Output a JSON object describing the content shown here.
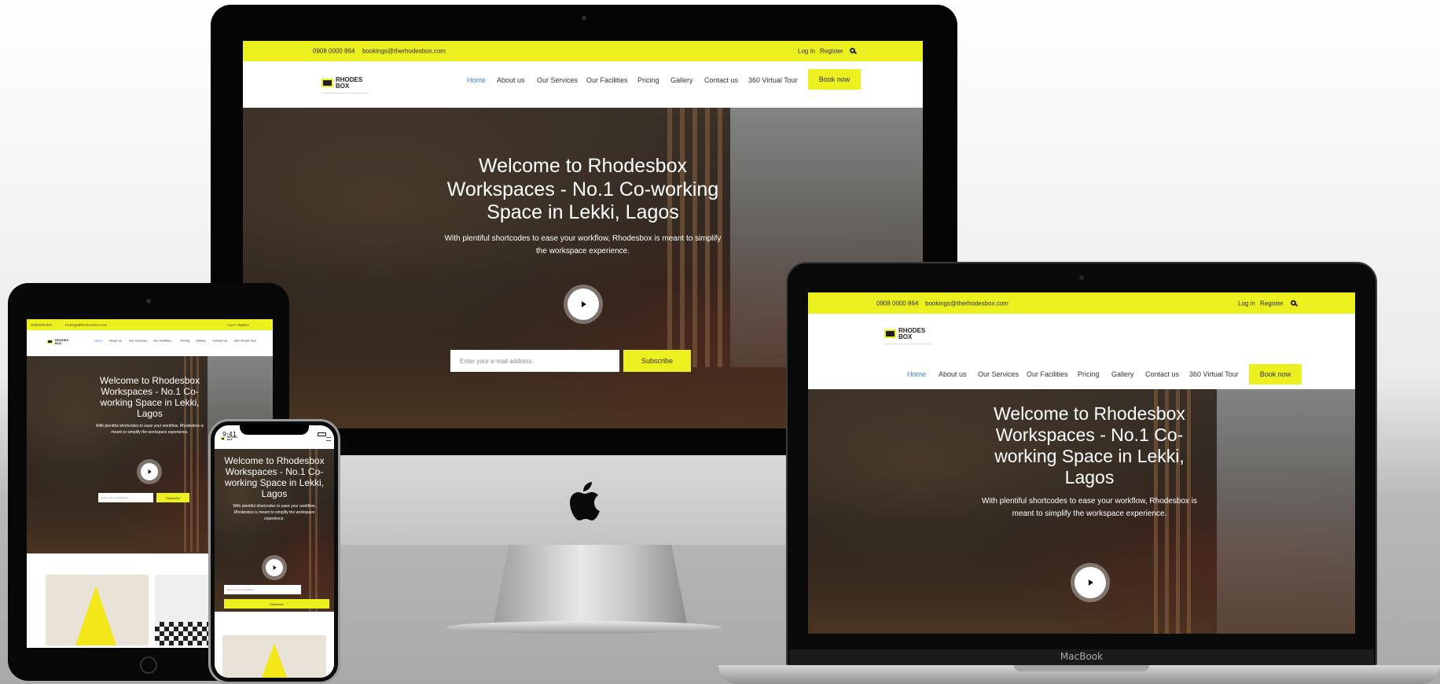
{
  "topbar": {
    "phone": "0908 0000 864",
    "email": "bookings@therhodesbox.com",
    "login": "Log in",
    "register": "Register"
  },
  "brand": {
    "name_line1": "RHODES",
    "name_line2": "BOX"
  },
  "nav": {
    "items": [
      "Home",
      "About us",
      "Our Services",
      "Our Facilities",
      "Pricing",
      "Gallery",
      "Contact us",
      "360 Virtual Tour"
    ],
    "active_index": 0,
    "book_label": "Book now"
  },
  "hero": {
    "title": "Welcome to Rhodesbox Workspaces - No.1 Co-working Space in Lekki, Lagos",
    "subtitle": "With plentiful shortcodes to ease your workflow, Rhodesbox is meant to simplify the workspace experience.",
    "email_placeholder": "Enter your e-mail address",
    "subscribe_label": "Subscribe"
  },
  "devices": {
    "laptop_label": "MacBook",
    "phone_time": "9:41"
  },
  "colors": {
    "accent": "#ecf01e",
    "active_link": "#3a7be6",
    "device_black": "#050505"
  },
  "icons": {
    "search": "search-icon",
    "play": "play-icon",
    "apple": "apple-logo-icon"
  }
}
